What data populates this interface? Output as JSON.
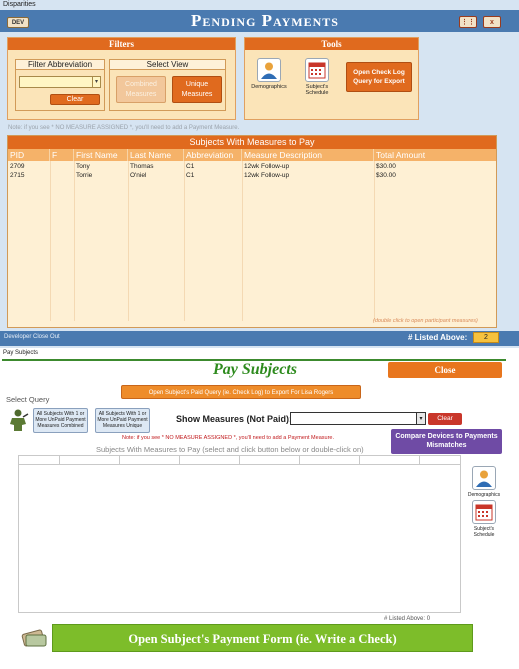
{
  "window1": {
    "title": "Disparities",
    "dev_label": "DEV",
    "app_title": "Pending Payments",
    "win_btn_1": "⋮⋮",
    "win_btn_2": "x",
    "filters": {
      "title": "Filters",
      "abbr_title": "Filter Abbreviation",
      "abbr_value": "",
      "clear_label": "Clear",
      "view_title": "Select View",
      "combined_label": "Combined Measures",
      "unique_label": "Unique Measures"
    },
    "tools": {
      "title": "Tools",
      "demographics_label": "Demographics",
      "schedule_label": "Subject's Schedule",
      "open_check_log_label": "Open Check Log Query for Export"
    },
    "note": "Note: if you see * NO MEASURE ASSIGNED *, you'll need to add a Payment Measure.",
    "grid": {
      "title": "Subjects With Measures to Pay",
      "columns": [
        "PID",
        "F",
        "First Name",
        "Last Name",
        "Abbreviation",
        "Measure Description",
        "Total Amount"
      ],
      "rows": [
        [
          "2709",
          "",
          "Tony",
          "Thomas",
          "C1",
          "12wk Follow-up",
          "$30.00"
        ],
        [
          "2715",
          "",
          "Torrie",
          "O'niel",
          "C1",
          "12wk Follow-up",
          "$30.00"
        ]
      ],
      "hint": "(double click to open participant measures)"
    },
    "footer": {
      "close_out": "Developer Close Out",
      "listed_label": "# Listed Above:",
      "listed_value": "2"
    },
    "colors": {
      "header": "#4a7ab0",
      "accent": "#e06a1e",
      "panel": "#fbe4b8"
    }
  },
  "window2": {
    "title": "Pay Subjects",
    "app_title": "Pay Subjects",
    "close_label": "Close",
    "export_label": "Open Subject's Paid Query (ie. Check Log) to Export For Lisa Rogers",
    "select_query_label": "Select Query",
    "query_combined_label": "All Subjects With 1 or More UnPaid Payment Measures Combined",
    "query_unique_label": "All Subjects With 1 or More UnPaid Payment Measures Unique",
    "show_measures_label": "Show Measures (Not Paid):",
    "show_measures_value": "",
    "clear_label": "Clear",
    "note": "Note: if you see * NO MEASURE ASSIGNED *, you'll need to add a Payment Measure.",
    "compare_label": "Compare Devices to Payments Mismatches",
    "grid_caption": "Subjects With Measures to Pay (select and click button below or double-click on)",
    "demographics_label": "Demographics",
    "schedule_label": "Subject's Schedule",
    "listed_text": "# Listed Above: 0",
    "pay_button_label": "Open Subject's Payment Form (ie. Write a Check)",
    "colors": {
      "title": "#2e8b1e",
      "close": "#e8761e",
      "compare": "#6f4ba5",
      "pay": "#7dbd2a"
    }
  }
}
